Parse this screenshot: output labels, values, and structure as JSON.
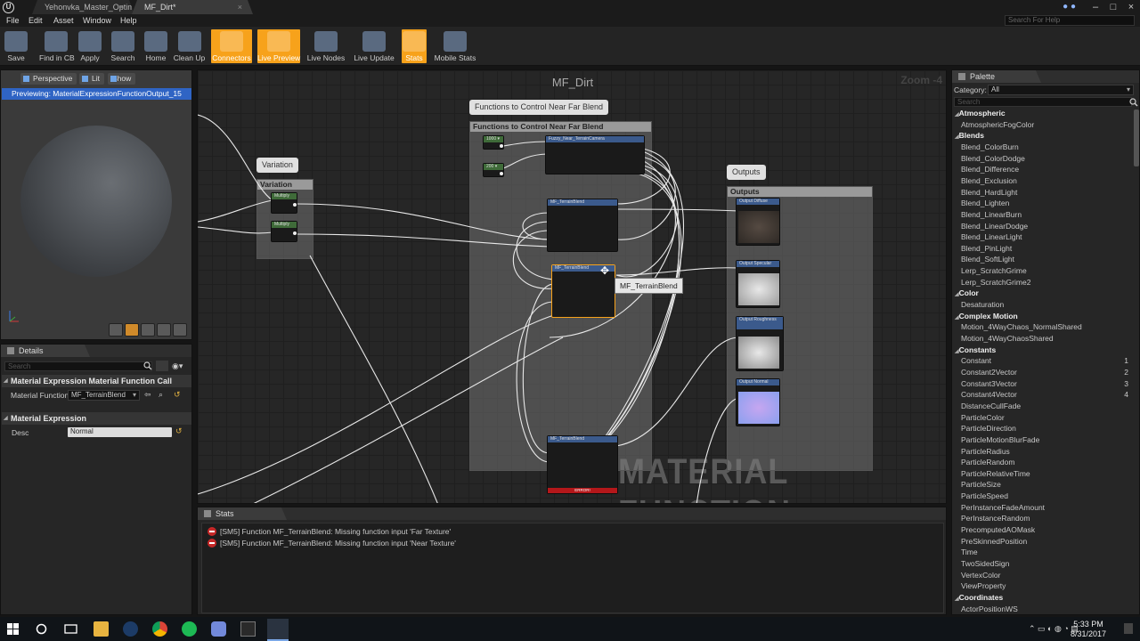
{
  "window": {
    "tabs": [
      "Yehonvka_Master_Optimiz",
      "MF_Dirt*"
    ]
  },
  "menu": [
    "File",
    "Edit",
    "Asset",
    "Window",
    "Help"
  ],
  "help_search_placeholder": "Search For Help",
  "toolbar": [
    {
      "label": "Save",
      "icon": "save-icon",
      "active": false
    },
    {
      "label": "Find in CB",
      "icon": "find-icon",
      "active": false
    },
    {
      "label": "Apply",
      "icon": "apply-icon",
      "active": false
    },
    {
      "label": "Search",
      "icon": "search-icon",
      "active": false
    },
    {
      "label": "Home",
      "icon": "home-icon",
      "active": false
    },
    {
      "label": "Clean Up",
      "icon": "clean-up-icon",
      "active": false
    },
    {
      "label": "Connectors",
      "icon": "connectors-icon",
      "active": true
    },
    {
      "label": "Live Preview",
      "icon": "live-preview-icon",
      "active": true
    },
    {
      "label": "Live Nodes",
      "icon": "live-nodes-icon",
      "active": false
    },
    {
      "label": "Live Update",
      "icon": "live-update-icon",
      "active": false
    },
    {
      "label": "Stats",
      "icon": "stats-icon",
      "active": true
    },
    {
      "label": "Mobile Stats",
      "icon": "mobile-stats-icon",
      "active": false
    }
  ],
  "viewport": {
    "buttons": [
      "Perspective",
      "Lit",
      "Show"
    ],
    "previewing": "Previewing: MaterialExpressionFunctionOutput_15"
  },
  "details": {
    "tab": "Details",
    "search_placeholder": "Search",
    "section1": "Material Expression Material Function Call",
    "material_function_label": "Material Function",
    "material_function_value": "MF_TerrainBlend",
    "section2": "Material Expression",
    "desc_label": "Desc",
    "desc_value": "Normal"
  },
  "graph": {
    "title": "MF_Dirt",
    "zoom": "Zoom -4",
    "watermark": "MATERIAL FUNCTION",
    "comment_variation": "Variation",
    "comment_functions": "Functions to Control Near Far Blend",
    "comment_outputs": "Outputs",
    "tooltip": "MF_TerrainBlend",
    "error_label": "ERROR!"
  },
  "stats": {
    "tab": "Stats",
    "messages": [
      "[SM5] Function MF_TerrainBlend: Missing function input 'Far Texture'",
      "[SM5] Function MF_TerrainBlend: Missing function input 'Near Texture'"
    ]
  },
  "palette": {
    "tab": "Palette",
    "category_label": "Category:",
    "category_value": "All",
    "search_placeholder": "Search",
    "items": [
      {
        "text": "Atmospheric",
        "cat": true
      },
      {
        "text": "AtmosphericFogColor"
      },
      {
        "text": "Blends",
        "cat": true
      },
      {
        "text": "Blend_ColorBurn"
      },
      {
        "text": "Blend_ColorDodge"
      },
      {
        "text": "Blend_Difference"
      },
      {
        "text": "Blend_Exclusion"
      },
      {
        "text": "Blend_HardLight"
      },
      {
        "text": "Blend_Lighten"
      },
      {
        "text": "Blend_LinearBurn"
      },
      {
        "text": "Blend_LinearDodge"
      },
      {
        "text": "Blend_LinearLight"
      },
      {
        "text": "Blend_PinLight"
      },
      {
        "text": "Blend_SoftLight"
      },
      {
        "text": "Lerp_ScratchGrime"
      },
      {
        "text": "Lerp_ScratchGrime2"
      },
      {
        "text": "Color",
        "cat": true
      },
      {
        "text": "Desaturation"
      },
      {
        "text": "Complex Motion",
        "cat": true
      },
      {
        "text": "Motion_4WayChaos_NormalShared"
      },
      {
        "text": "Motion_4WayChaosShared"
      },
      {
        "text": "Constants",
        "cat": true
      },
      {
        "text": "Constant",
        "shortcut": "1"
      },
      {
        "text": "Constant2Vector",
        "shortcut": "2"
      },
      {
        "text": "Constant3Vector",
        "shortcut": "3"
      },
      {
        "text": "Constant4Vector",
        "shortcut": "4"
      },
      {
        "text": "DistanceCullFade"
      },
      {
        "text": "ParticleColor"
      },
      {
        "text": "ParticleDirection"
      },
      {
        "text": "ParticleMotionBlurFade"
      },
      {
        "text": "ParticleRadius"
      },
      {
        "text": "ParticleRandom"
      },
      {
        "text": "ParticleRelativeTime"
      },
      {
        "text": "ParticleSize"
      },
      {
        "text": "ParticleSpeed"
      },
      {
        "text": "PerInstanceFadeAmount"
      },
      {
        "text": "PerInstanceRandom"
      },
      {
        "text": "PrecomputedAOMask"
      },
      {
        "text": "PreSkinnedPosition"
      },
      {
        "text": "Time"
      },
      {
        "text": "TwoSidedSign"
      },
      {
        "text": "VertexColor"
      },
      {
        "text": "ViewProperty"
      },
      {
        "text": "Coordinates",
        "cat": true
      },
      {
        "text": "ActorPositionWS"
      }
    ]
  },
  "taskbar": {
    "time": "5:33 PM",
    "date": "8/31/2017"
  },
  "colors": {
    "accent": "#f7a21b",
    "selection": "#2f64c4",
    "error": "#c62828"
  }
}
